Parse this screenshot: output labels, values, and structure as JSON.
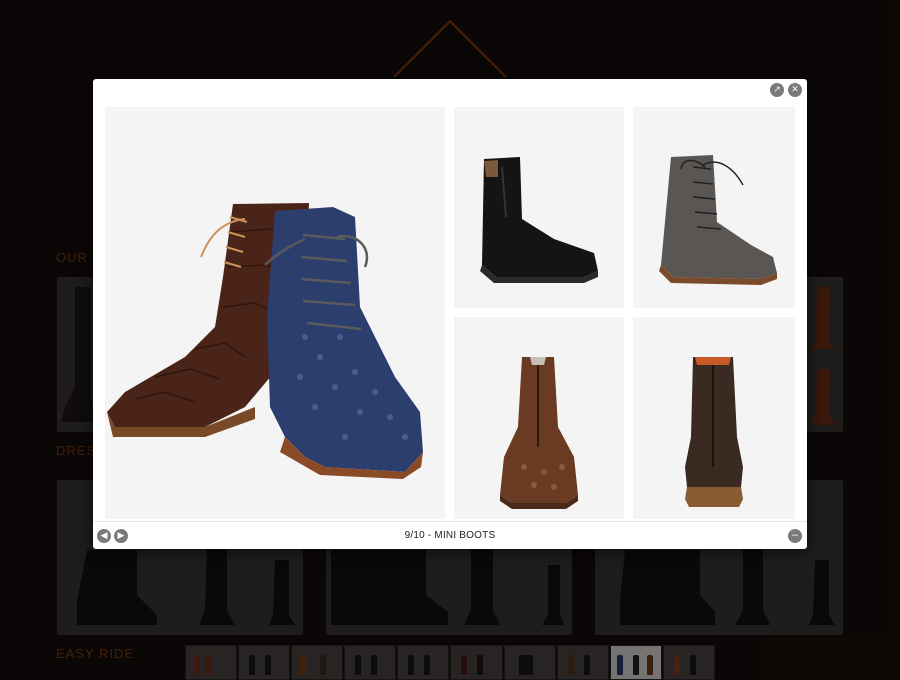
{
  "background": {
    "headings": {
      "our": "OUR",
      "dress": "DRESS",
      "easy_ride": "EASY RIDE"
    },
    "accent_color": "#7a3a14"
  },
  "lightbox": {
    "caption": "9/10 - MINI BOOTS",
    "current_index": 9,
    "total": 10,
    "icons": {
      "expand": "expand-icon",
      "close": "close-icon",
      "prev": "chevron-left-icon",
      "next": "chevron-right-icon",
      "zoom_out": "minus-icon"
    },
    "image": {
      "main": "two-lace-up-boots-croc-and-ostrich",
      "tiles": [
        "black-chelsea-boot",
        "grey-lace-up-boot",
        "brown-zip-boot-front",
        "dark-brown-zip-boot-back"
      ]
    }
  }
}
